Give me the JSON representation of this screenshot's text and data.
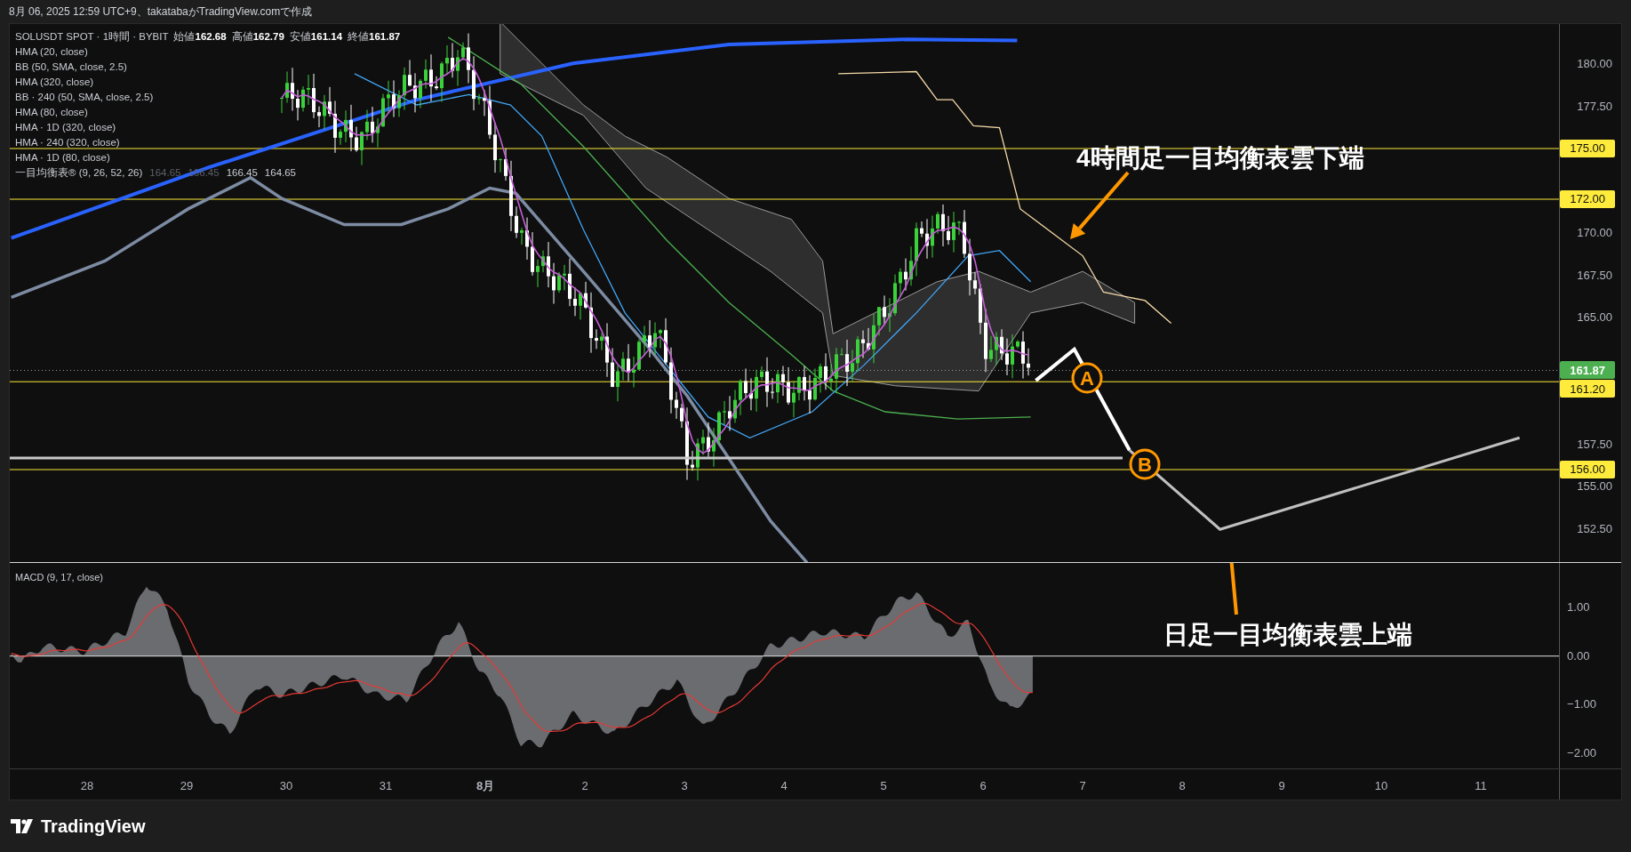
{
  "header": {
    "caption": "8月 06, 2025 12:59 UTC+9、takatabaがTradingView.comで作成"
  },
  "legend": {
    "symbol": "SOLUSDT SPOT · 1時間 · BYBIT",
    "ohlc": [
      {
        "label": "始値",
        "value": "162.68"
      },
      {
        "label": "高値",
        "value": "162.79"
      },
      {
        "label": "安値",
        "value": "161.14"
      },
      {
        "label": "終値",
        "value": "161.87"
      }
    ],
    "indicators": [
      "HMA (20, close)",
      "BB (50, SMA, close, 2.5)",
      "HMA (320, close)",
      "BB · 240 (50, SMA, close, 2.5)",
      "HMA (80, close)",
      "HMA · 1D (320, close)",
      "HMA · 240 (320, close)",
      "HMA · 1D (80, close)"
    ],
    "ichimoku": {
      "name": "一目均衡表® (9, 26, 52, 26)",
      "values": [
        {
          "text": "164.65",
          "dim": true
        },
        {
          "text": "166.45",
          "dim": true
        },
        {
          "text": "166.45",
          "dim": false
        },
        {
          "text": "164.65",
          "dim": false
        }
      ]
    }
  },
  "price_axis": {
    "ticks": [
      "180.00",
      "177.50",
      "170.00",
      "167.50",
      "165.00",
      "157.50",
      "155.00",
      "152.50"
    ],
    "badges": [
      {
        "text": "175.00",
        "color": "#ffeb3b"
      },
      {
        "text": "172.00",
        "color": "#ffeb3b"
      },
      {
        "text": "161.87",
        "color": "#4caf50"
      },
      {
        "text": "161.20",
        "color": "#ffeb3b"
      },
      {
        "text": "156.00",
        "color": "#ffeb3b"
      }
    ]
  },
  "annotations": [
    {
      "text": "4時間足一目均衡表雲下端"
    },
    {
      "text": "日足一目均衡表雲上端"
    }
  ],
  "markers": [
    "A",
    "B"
  ],
  "macd": {
    "title": "MACD (9, 17, close)",
    "ticks": [
      "1.00",
      "0.00",
      "−1.00",
      "−2.00"
    ]
  },
  "time_axis": [
    {
      "label": "28",
      "bold": false
    },
    {
      "label": "29",
      "bold": false
    },
    {
      "label": "30",
      "bold": false
    },
    {
      "label": "31",
      "bold": false
    },
    {
      "label": "8月",
      "bold": true
    },
    {
      "label": "2",
      "bold": false
    },
    {
      "label": "3",
      "bold": false
    },
    {
      "label": "4",
      "bold": false
    },
    {
      "label": "5",
      "bold": false
    },
    {
      "label": "6",
      "bold": false
    },
    {
      "label": "7",
      "bold": false
    },
    {
      "label": "8",
      "bold": false
    },
    {
      "label": "9",
      "bold": false
    },
    {
      "label": "10",
      "bold": false
    },
    {
      "label": "11",
      "bold": false
    }
  ],
  "footer": {
    "brand": "TradingView"
  }
}
